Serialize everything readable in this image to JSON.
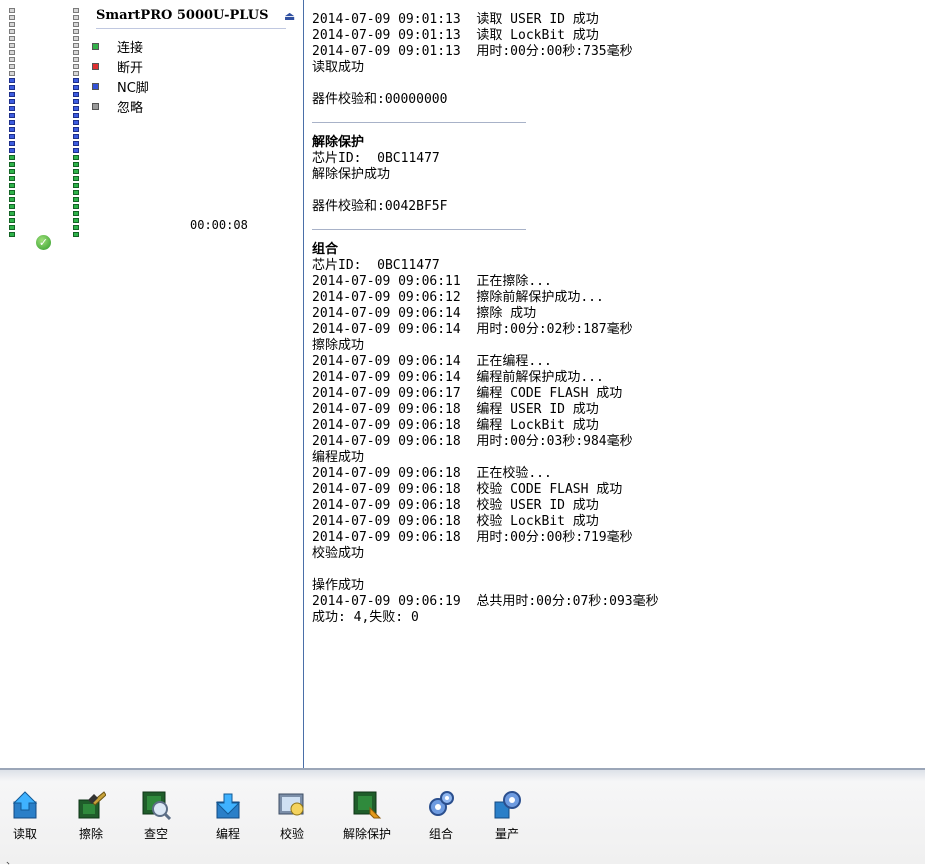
{
  "device": {
    "title": "SmartPRO 5000U-PLUS",
    "timer": "00:00:08"
  },
  "legend": [
    {
      "label": "连接",
      "color": "#33b24a"
    },
    {
      "label": "断开",
      "color": "#e03030"
    },
    {
      "label": "NC脚",
      "color": "#3353d8"
    },
    {
      "label": "忽略",
      "color": "#9a9a9a"
    }
  ],
  "log": {
    "section1": [
      "2014-07-09 09:01:13  读取 USER ID 成功",
      "2014-07-09 09:01:13  读取 LockBit 成功",
      "2014-07-09 09:01:13  用时:00分:00秒:735毫秒",
      "读取成功",
      "",
      "器件校验和:00000000"
    ],
    "section2": {
      "heading": "解除保护",
      "lines": [
        "芯片ID:  0BC11477",
        "解除保护成功",
        "",
        "器件校验和:0042BF5F"
      ]
    },
    "section3": {
      "heading": "组合",
      "lines": [
        "芯片ID:  0BC11477",
        "2014-07-09 09:06:11  正在擦除...",
        "2014-07-09 09:06:12  擦除前解保护成功...",
        "2014-07-09 09:06:14  擦除 成功",
        "2014-07-09 09:06:14  用时:00分:02秒:187毫秒",
        "擦除成功",
        "2014-07-09 09:06:14  正在编程...",
        "2014-07-09 09:06:14  编程前解保护成功...",
        "2014-07-09 09:06:17  编程 CODE FLASH 成功",
        "2014-07-09 09:06:18  编程 USER ID 成功",
        "2014-07-09 09:06:18  编程 LockBit 成功",
        "2014-07-09 09:06:18  用时:00分:03秒:984毫秒",
        "编程成功",
        "2014-07-09 09:06:18  正在校验...",
        "2014-07-09 09:06:18  校验 CODE FLASH 成功",
        "2014-07-09 09:06:18  校验 USER ID 成功",
        "2014-07-09 09:06:18  校验 LockBit 成功",
        "2014-07-09 09:06:18  用时:00分:00秒:719毫秒",
        "校验成功",
        "",
        "操作成功",
        "2014-07-09 09:06:19  总共用时:00分:07秒:093毫秒",
        "成功: 4,失败: 0"
      ]
    }
  },
  "toolbar": [
    {
      "label": "读取",
      "icon": "read-icon"
    },
    {
      "label": "擦除",
      "icon": "erase-icon"
    },
    {
      "label": "查空",
      "icon": "blank-check-icon"
    },
    {
      "label": "编程",
      "icon": "program-icon"
    },
    {
      "label": "校验",
      "icon": "verify-icon"
    },
    {
      "label": "解除保护",
      "icon": "unprotect-icon"
    },
    {
      "label": "组合",
      "icon": "combo-gear-icon"
    },
    {
      "label": "量产",
      "icon": "mass-production-icon"
    }
  ],
  "status": {
    "left_text": "、"
  }
}
